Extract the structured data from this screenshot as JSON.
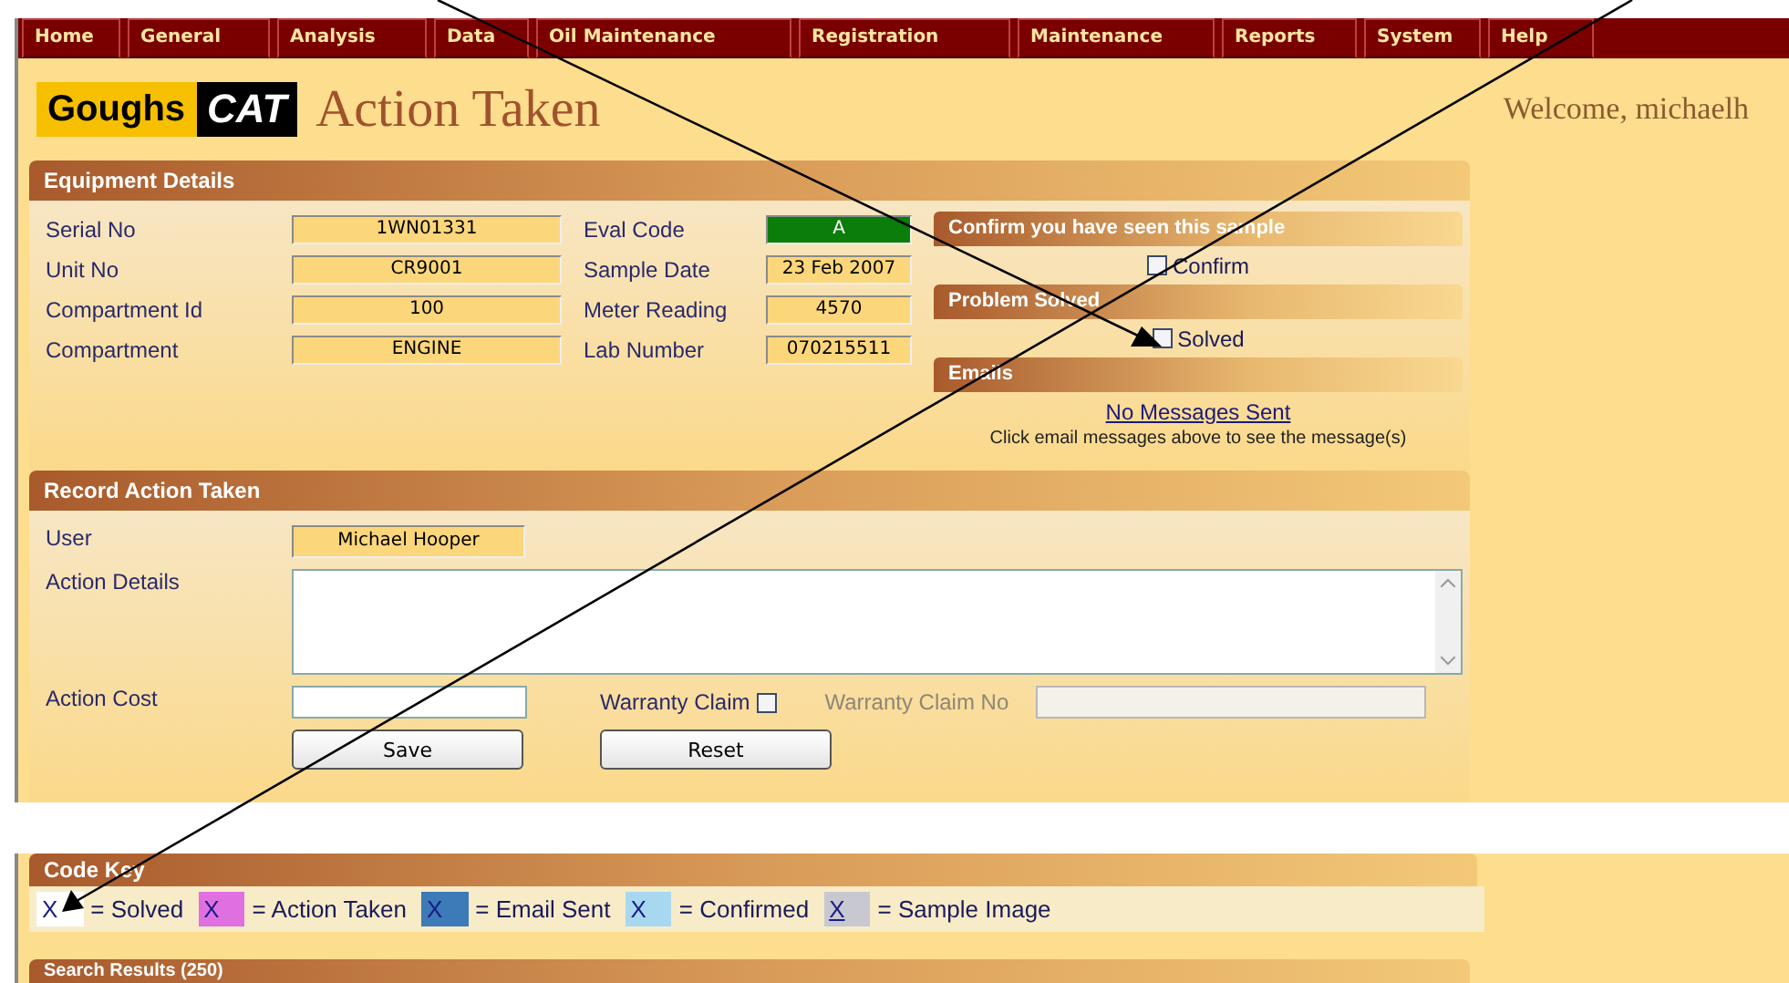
{
  "menu": [
    "Home",
    "General",
    "Analysis",
    "Data",
    "Oil Maintenance",
    "Registration",
    "Maintenance",
    "Reports",
    "System",
    "Help"
  ],
  "brand": {
    "name": "Goughs",
    "logo": "CAT"
  },
  "page_title": "Action Taken",
  "welcome": "Welcome, michaelh",
  "equipment": {
    "title": "Equipment Details",
    "left_fields": [
      {
        "label": "Serial No",
        "value": "1WN01331"
      },
      {
        "label": "Unit No",
        "value": "CR9001"
      },
      {
        "label": "Compartment Id",
        "value": "100"
      },
      {
        "label": "Compartment",
        "value": "ENGINE"
      }
    ],
    "right_fields": [
      {
        "label": "Eval Code",
        "value": "A",
        "color": "#0a7d0a"
      },
      {
        "label": "Sample Date",
        "value": "23 Feb 2007"
      },
      {
        "label": "Meter Reading",
        "value": "4570"
      },
      {
        "label": "Lab Number",
        "value": "070215511"
      }
    ]
  },
  "confirm": {
    "title": "Confirm you have seen this sample",
    "label": "Confirm",
    "checked": false
  },
  "problem_solved": {
    "title": "Problem Solved",
    "label": "Solved",
    "checked": false
  },
  "emails": {
    "title": "Emails",
    "link": "No Messages Sent",
    "note": "Click email messages above to see the message(s)"
  },
  "record": {
    "title": "Record Action Taken",
    "user": {
      "label": "User",
      "value": "Michael Hooper"
    },
    "details": {
      "label": "Action Details"
    },
    "cost": {
      "label": "Action Cost"
    },
    "warranty": {
      "label": "Warranty Claim",
      "checked": false
    },
    "warranty_no": {
      "label": "Warranty Claim No",
      "disabled": true
    },
    "buttons": [
      "Save",
      "Reset"
    ]
  },
  "code_key": {
    "title": "Code Key",
    "items": [
      {
        "mark": "X",
        "label": "= Solved",
        "color": "#ffffff",
        "underlined": false
      },
      {
        "mark": "X",
        "label": "= Action Taken",
        "color": "#e070e0",
        "underlined": false
      },
      {
        "mark": "X",
        "label": "= Email Sent",
        "color": "#3d7ab8",
        "underlined": false
      },
      {
        "mark": "X",
        "label": "= Confirmed",
        "color": "#a8d8f0",
        "underlined": false
      },
      {
        "mark": "X",
        "label": "= Sample Image",
        "color": "#c8c8d0",
        "underlined": true
      }
    ]
  },
  "search": {
    "title": "Search Results (250)"
  }
}
